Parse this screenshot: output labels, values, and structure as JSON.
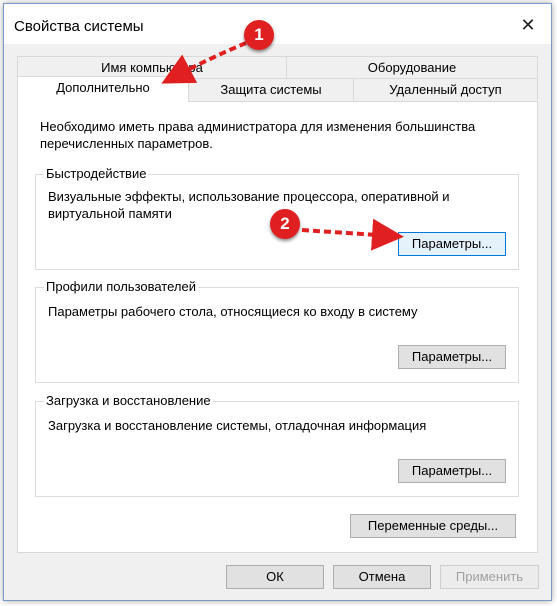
{
  "window": {
    "title": "Свойства системы",
    "close_glyph": "✕"
  },
  "tabs_row1": [
    {
      "label": "Имя компьютера"
    },
    {
      "label": "Оборудование"
    }
  ],
  "tabs_row2": [
    {
      "label": "Дополнительно",
      "active": true
    },
    {
      "label": "Защита системы"
    },
    {
      "label": "Удаленный доступ"
    }
  ],
  "notice": "Необходимо иметь права администратора для изменения большинства перечисленных параметров.",
  "sections": [
    {
      "title": "Быстродействие",
      "description": "Визуальные эффекты, использование процессора, оперативной и виртуальной памяти",
      "button": "Параметры..."
    },
    {
      "title": "Профили пользователей",
      "description": "Параметры рабочего стола, относящиеся ко входу в систему",
      "button": "Параметры..."
    },
    {
      "title": "Загрузка и восстановление",
      "description": "Загрузка и восстановление системы, отладочная информация",
      "button": "Параметры..."
    }
  ],
  "env_button": "Переменные среды...",
  "footer": {
    "ok": "ОК",
    "cancel": "Отмена",
    "apply": "Применить"
  },
  "annotations": {
    "badge1": "1",
    "badge2": "2",
    "color": "#e02020"
  }
}
